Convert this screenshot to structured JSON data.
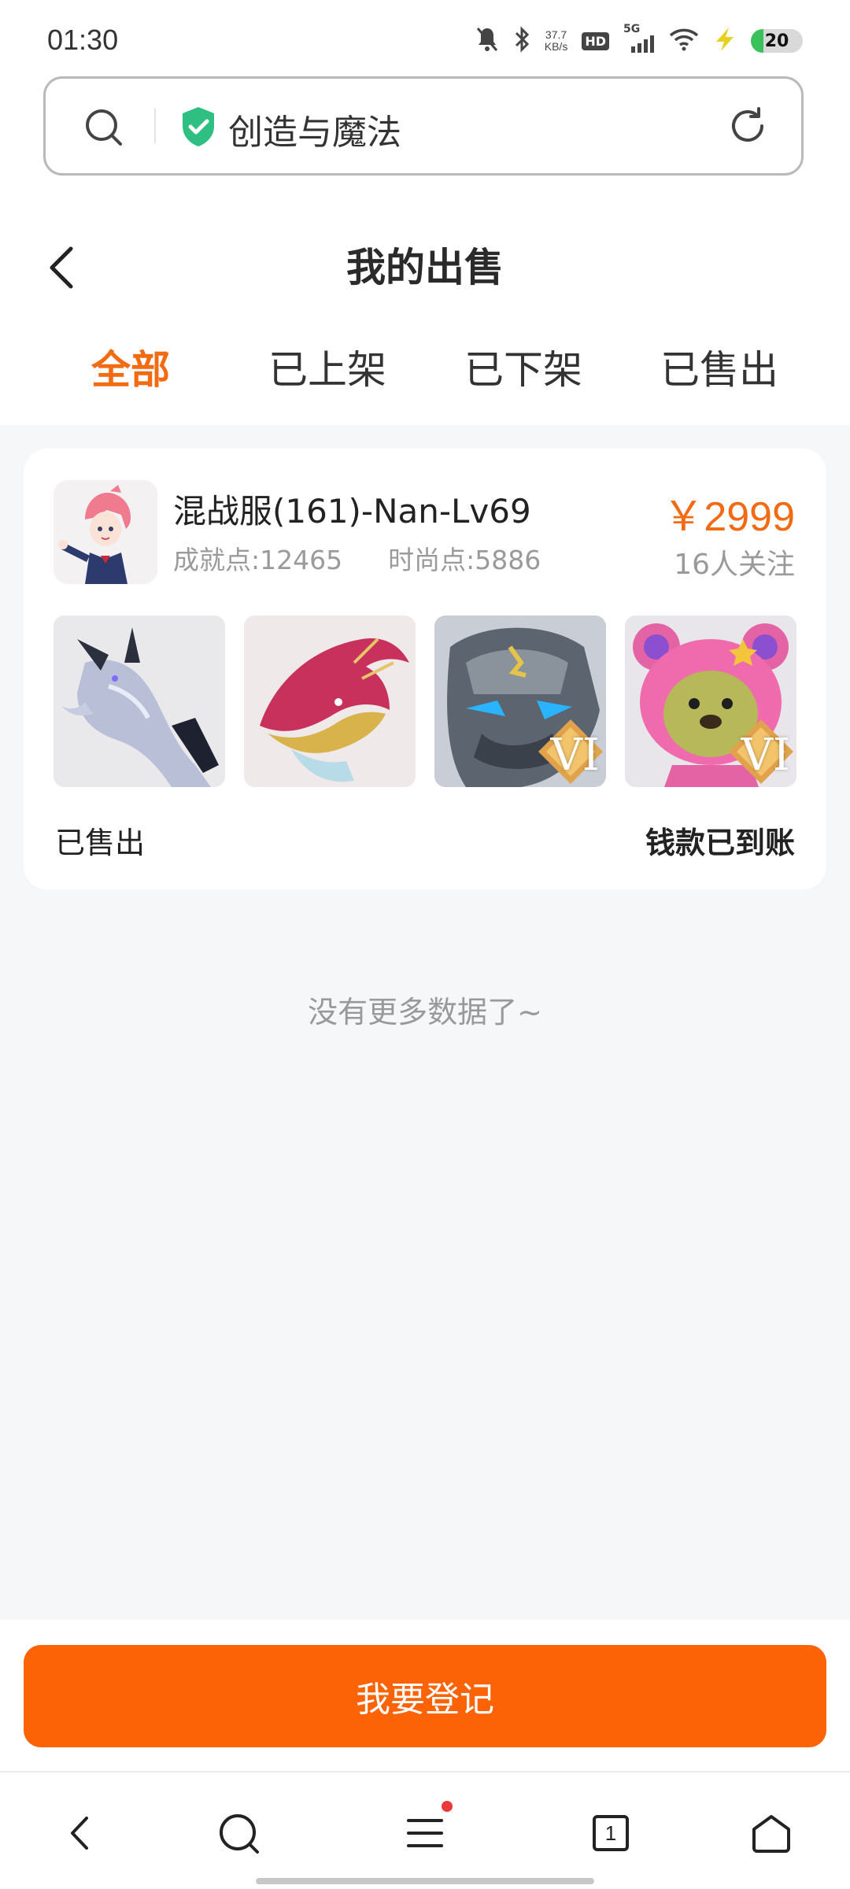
{
  "status_bar": {
    "time": "01:30",
    "net_speed_value": "37.7",
    "net_speed_unit": "KB/s",
    "hd_label": "HD",
    "network_label": "5G",
    "battery_level": "20"
  },
  "browser": {
    "address_text": "创造与魔法"
  },
  "header": {
    "title": "我的出售",
    "tabs": [
      {
        "label": "全部",
        "active": true
      },
      {
        "label": "已上架",
        "active": false
      },
      {
        "label": "已下架",
        "active": false
      },
      {
        "label": "已售出",
        "active": false
      }
    ]
  },
  "listing": {
    "account_name": "混战服(161)-Nan-Lv69",
    "achievement_points": "成就点:12465",
    "fashion_points": "时尚点:5886",
    "price": "￥2999",
    "followers": "16人关注",
    "thumbnails": [
      {
        "name": "silver-dragon-mount",
        "badge": ""
      },
      {
        "name": "red-gold-dragon-mount",
        "badge": ""
      },
      {
        "name": "stone-beast-mount",
        "badge": "VI"
      },
      {
        "name": "pink-bear-pet",
        "badge": "VI"
      }
    ],
    "status": "已售出",
    "payment_status": "钱款已到账"
  },
  "list_end_text": "没有更多数据了~",
  "action_button": "我要登记",
  "bottom_nav": {
    "tab_count": "1"
  },
  "colors": {
    "accent": "#f26a12",
    "button": "#fb6306",
    "badge_dot": "#ea3b3b",
    "shield": "#2fbf83"
  }
}
